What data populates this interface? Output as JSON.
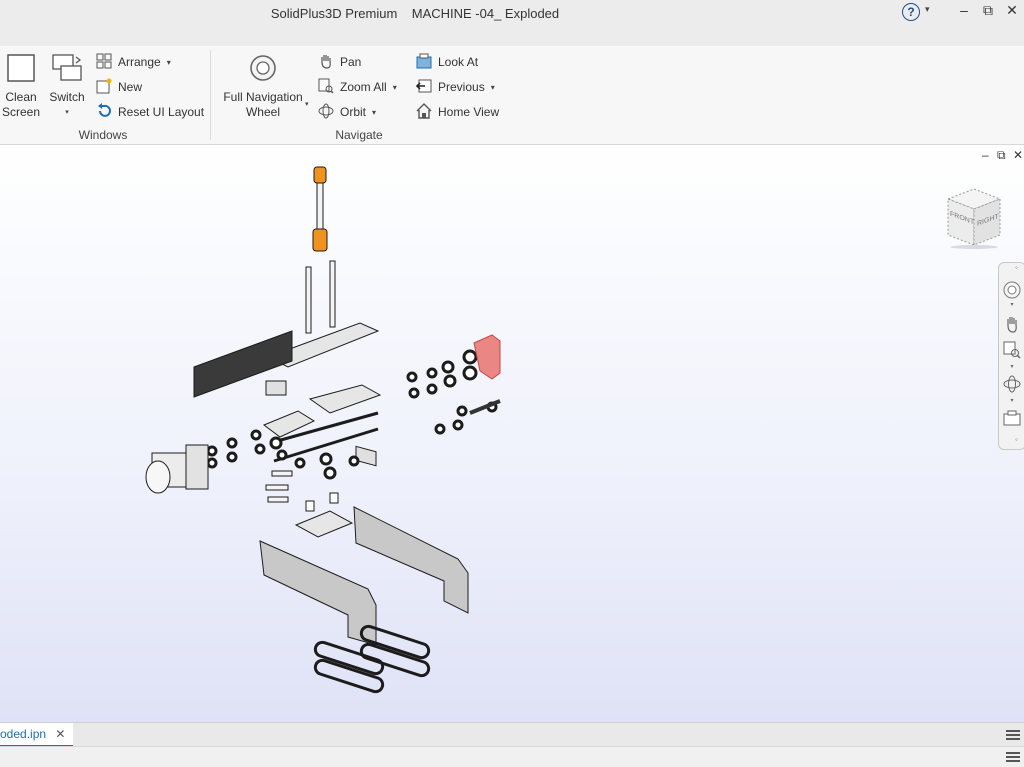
{
  "window": {
    "title": "SolidPlus3D Premium    MACHINE -04_ Exploded",
    "help_icon": "?",
    "help_caret": "▾",
    "minimize": "–",
    "maximize": "⧉",
    "close": "✕"
  },
  "ribbon": {
    "windows_group": {
      "label": "Windows",
      "clean_screen": "Clean\nScreen",
      "switch": "Switch",
      "arrange": "Arrange",
      "new": "New",
      "reset_ui_layout": "Reset UI Layout"
    },
    "navigate_group": {
      "label": "Navigate",
      "full_navigation_wheel": "Full Navigation\nWheel",
      "pan": "Pan",
      "zoom_all": "Zoom All",
      "orbit": "Orbit",
      "look_at": "Look At",
      "previous": "Previous",
      "home_view": "Home View"
    }
  },
  "viewport": {
    "controls": {
      "minimize": "–",
      "restore": "⧉",
      "close": "✕"
    },
    "viewcube": {
      "front": "FRONT",
      "right": "RIGHT"
    }
  },
  "document_tab": {
    "label": "oded.ipn",
    "close": "✕"
  },
  "colors": {
    "accent": "#1a6fb5",
    "highlight_part": "#e8736f",
    "orange_part": "#f0921e"
  }
}
